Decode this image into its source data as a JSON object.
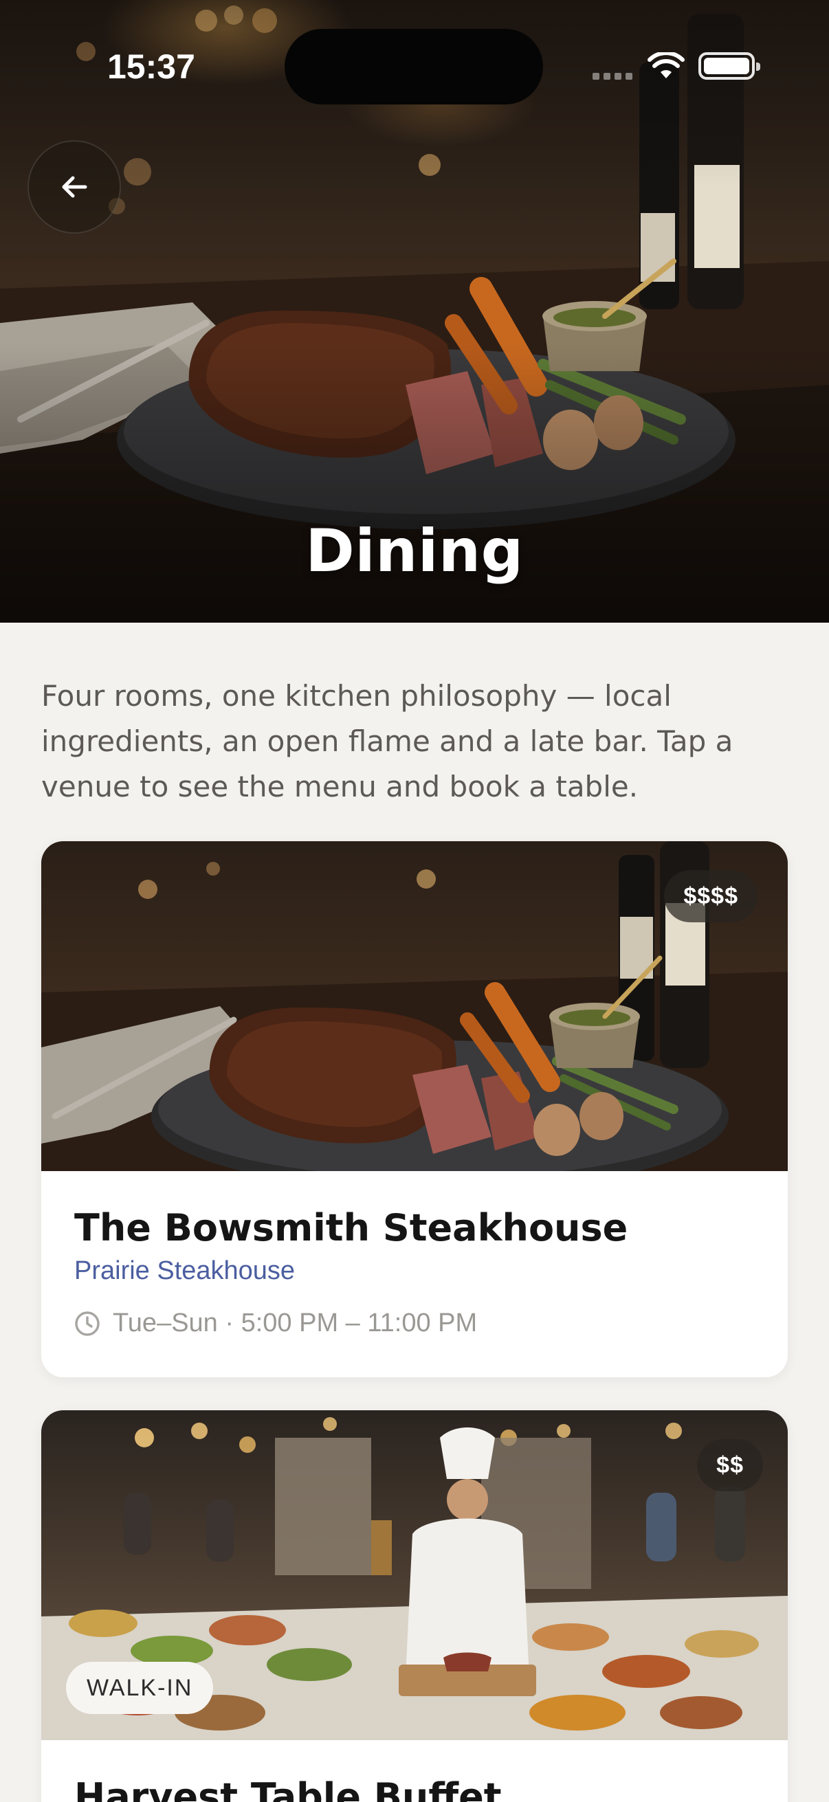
{
  "status_bar": {
    "time": "15:37"
  },
  "hero": {
    "title": "Dining",
    "back_icon": "arrow-left-icon"
  },
  "intro": {
    "text": "Four rooms, one kitchen philosophy — local ingredients, an open flame and a late bar. Tap a venue to see the menu and book a table."
  },
  "venues": [
    {
      "name": "The Bowsmith Steakhouse",
      "cuisine": "Prairie Steakhouse",
      "hours": "Tue–Sun · 5:00 PM – 11:00 PM",
      "price": "$$$$",
      "hours_icon": "clock-icon"
    },
    {
      "name": "Harvest Table Buffet",
      "price": "$$",
      "badge": "WALK-IN"
    }
  ],
  "colors": {
    "background": "#f4f2ef",
    "accent_subtitle": "#4b5ea0",
    "card": "#ffffff"
  }
}
